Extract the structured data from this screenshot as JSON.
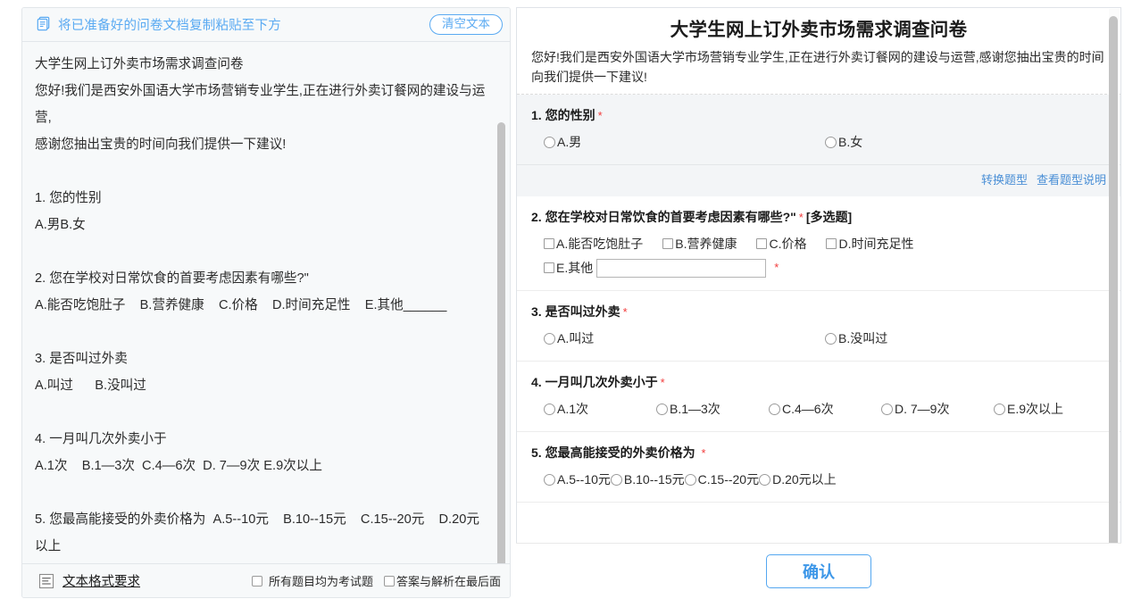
{
  "left_panel": {
    "header": {
      "icon": "copy-document-icon",
      "title": "将已准备好的问卷文档复制粘贴至下方",
      "clear_button": "清空文本"
    },
    "document_lines": [
      "大学生网上订外卖市场需求调查问卷",
      "您好!我们是西安外国语大学市场营销专业学生,正在进行外卖订餐网的建设与运营,",
      "感谢您抽出宝贵的时间向我们提供一下建议!",
      "",
      "1. 您的性别",
      "A.男B.女",
      "",
      "2. 您在学校对日常饮食的首要考虑因素有哪些?\"",
      "A.能否吃饱肚子    B.营养健康    C.价格    D.时间充足性    E.其他______",
      "",
      "3. 是否叫过外卖",
      "A.叫过      B.没叫过",
      "",
      "4. 一月叫几次外卖小于",
      "A.1次    B.1—3次  C.4—6次  D. 7—9次 E.9次以上",
      "",
      "5. 您最高能接受的外卖价格为  A.5--10元    B.10--15元    C.15--20元    D.20元以上"
    ],
    "footer": {
      "icon": "text-format-icon",
      "format_link": "文本格式要求 ",
      "checkbox_exam": "所有题目均为考试题",
      "checkbox_answer": "答案与解析在最后面"
    }
  },
  "right_panel": {
    "title": "大学生网上订外卖市场需求调查问卷",
    "description": "您好!我们是西安外国语大学市场营销专业学生,正在进行外卖订餐网的建设与运营,感谢您抽出宝贵的时间向我们提供一下建议!",
    "required_mark": "*",
    "questions": [
      {
        "number": "1.",
        "text": "您的性别",
        "required": "*",
        "type_tag": "",
        "layout": "two",
        "input_type": "radio",
        "options": [
          "A.男",
          "B.女"
        ],
        "actions": [
          "转换题型",
          "查看题型说明"
        ],
        "active": true
      },
      {
        "number": "2.",
        "text": "您在学校对日常饮食的首要考虑因素有哪些?\"",
        "required": "*",
        "type_tag": "[多选题]",
        "layout": "q2",
        "input_type": "checkbox",
        "options": [
          "A.能否吃饱肚子",
          "B.营养健康",
          "C.价格",
          "D.时间充足性"
        ],
        "other_option": {
          "label": "E.其他",
          "value": "",
          "required": "*"
        },
        "active": false
      },
      {
        "number": "3.",
        "text": "是否叫过外卖",
        "required": "*",
        "type_tag": "",
        "layout": "two",
        "input_type": "radio",
        "options": [
          "A.叫过",
          "B.没叫过"
        ],
        "active": false
      },
      {
        "number": "4.",
        "text": "一月叫几次外卖小于",
        "required": "*",
        "type_tag": "",
        "layout": "five",
        "input_type": "radio",
        "options": [
          "A.1次",
          "B.1—3次",
          "C.4—6次",
          "D. 7—9次",
          "E.9次以上"
        ],
        "active": false
      },
      {
        "number": "5.",
        "text": "您最高能接受的外卖价格为 ",
        "required": "*",
        "type_tag": "",
        "layout": "four",
        "input_type": "radio",
        "options": [
          "A.5--10元",
          "B.10--15元",
          "C.15--20元",
          "D.20元以上"
        ],
        "active": false
      }
    ]
  },
  "confirm_button": "确认",
  "colors": {
    "accent_blue": "#5aaaf2",
    "link_blue": "#4a8fd6",
    "required_red": "#f23c3c",
    "panel_bg": "#f7f9fa",
    "active_question_bg": "#f3f5f7"
  }
}
